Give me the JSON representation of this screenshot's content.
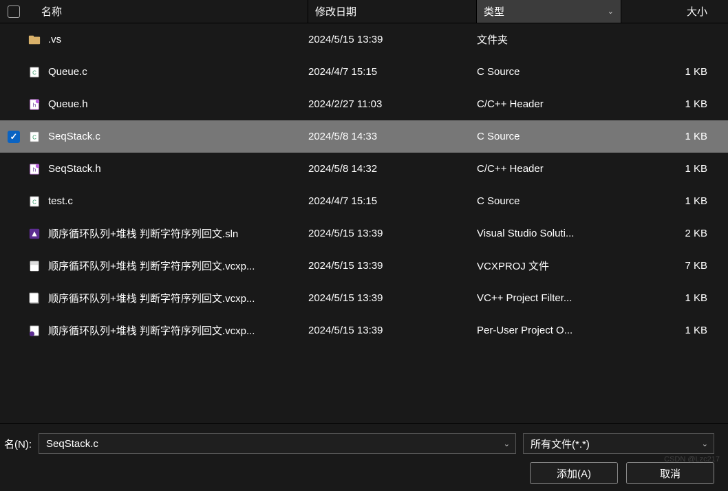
{
  "columns": {
    "name": "名称",
    "date": "修改日期",
    "type": "类型",
    "size": "大小"
  },
  "files": [
    {
      "icon": "folder",
      "name": ".vs",
      "date": "2024/5/15 13:39",
      "type": "文件夹",
      "size": "",
      "checked": false,
      "selected": false
    },
    {
      "icon": "c-file",
      "name": "Queue.c",
      "date": "2024/4/7 15:15",
      "type": "C Source",
      "size": "1 KB",
      "checked": false,
      "selected": false
    },
    {
      "icon": "h-file",
      "name": "Queue.h",
      "date": "2024/2/27 11:03",
      "type": "C/C++ Header",
      "size": "1 KB",
      "checked": false,
      "selected": false
    },
    {
      "icon": "c-file",
      "name": "SeqStack.c",
      "date": "2024/5/8 14:33",
      "type": "C Source",
      "size": "1 KB",
      "checked": true,
      "selected": true
    },
    {
      "icon": "h-file",
      "name": "SeqStack.h",
      "date": "2024/5/8 14:32",
      "type": "C/C++ Header",
      "size": "1 KB",
      "checked": false,
      "selected": false
    },
    {
      "icon": "c-file",
      "name": "test.c",
      "date": "2024/4/7 15:15",
      "type": "C Source",
      "size": "1 KB",
      "checked": false,
      "selected": false
    },
    {
      "icon": "sln",
      "name": "顺序循环队列+堆栈 判断字符序列回文.sln",
      "date": "2024/5/15 13:39",
      "type": "Visual Studio Soluti...",
      "size": "2 KB",
      "checked": false,
      "selected": false
    },
    {
      "icon": "vcxproj",
      "name": "顺序循环队列+堆栈 判断字符序列回文.vcxp...",
      "date": "2024/5/15 13:39",
      "type": "VCXPROJ 文件",
      "size": "7 KB",
      "checked": false,
      "selected": false
    },
    {
      "icon": "filters",
      "name": "顺序循环队列+堆栈 判断字符序列回文.vcxp...",
      "date": "2024/5/15 13:39",
      "type": "VC++ Project Filter...",
      "size": "1 KB",
      "checked": false,
      "selected": false
    },
    {
      "icon": "user",
      "name": "顺序循环队列+堆栈 判断字符序列回文.vcxp...",
      "date": "2024/5/15 13:39",
      "type": "Per-User Project O...",
      "size": "1 KB",
      "checked": false,
      "selected": false
    }
  ],
  "footer": {
    "filename_label": "名(N):",
    "filename_value": "SeqStack.c",
    "filter_value": "所有文件(*.*)",
    "add_label": "添加(A)",
    "cancel_label": "取消"
  },
  "watermark": "CSDN @Lzc217"
}
